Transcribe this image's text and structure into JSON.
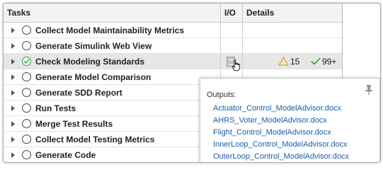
{
  "columns": {
    "tasks": "Tasks",
    "io": "I/O",
    "details": "Details"
  },
  "tasks": [
    {
      "label": "Collect Model Maintainability Metrics",
      "status": "not-run"
    },
    {
      "label": "Generate Simulink Web View",
      "status": "not-run"
    },
    {
      "label": "Check Modeling Standards",
      "status": "passed",
      "selected": true,
      "warnings": "15",
      "passed": "99+"
    },
    {
      "label": "Generate Model Comparison",
      "status": "not-run"
    },
    {
      "label": "Generate SDD Report",
      "status": "not-run"
    },
    {
      "label": "Run Tests",
      "status": "not-run"
    },
    {
      "label": "Merge Test Results",
      "status": "not-run"
    },
    {
      "label": "Collect Model Testing Metrics",
      "status": "not-run"
    },
    {
      "label": "Generate Code",
      "status": "not-run"
    }
  ],
  "outputs_popup": {
    "title": "Outputs:",
    "files": [
      "Actuator_Control_ModelAdvisor.docx",
      "AHRS_Voter_ModelAdvisor.docx",
      "Flight_Control_ModelAdvisor.docx",
      "InnerLoop_Control_ModelAdvisor.docx",
      "OuterLoop_Control_ModelAdvisor.docx"
    ]
  },
  "colors": {
    "warning": "#e8a317",
    "passed": "#2e9b2e",
    "link": "#1a5ea8"
  },
  "icons": {
    "expand": "chevron-right-icon",
    "status_not_run": "circle-icon",
    "status_passed": "check-circle-icon",
    "io": "document-icon",
    "warning": "warning-triangle-icon",
    "passed_check": "checkmark-icon",
    "pin": "pin-icon",
    "cursor": "hand-cursor-icon"
  }
}
